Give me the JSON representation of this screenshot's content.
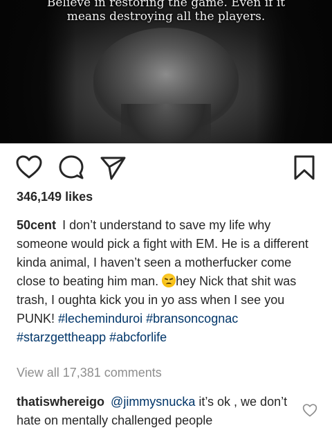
{
  "post": {
    "image": {
      "quote_line1": "Believe in restoring the game. Even if it",
      "quote_line2": "means destroying all the players."
    },
    "actions": {
      "like_icon": "heart-icon",
      "comment_icon": "comment-bubble-icon",
      "share_icon": "paper-plane-icon",
      "save_icon": "bookmark-icon"
    },
    "likes_text": "346,149 likes",
    "caption": {
      "username": "50cent",
      "text_part1": "I don’t understand to save my life why someone would pick a fight with EM. He is a different kinda animal, I haven’t seen a motherfucker come close to beating him man.",
      "emoji": "angry-face-emoji",
      "text_part2": "hey Nick that shit was trash, I oughta kick you in yo ass when I see you PUNK!",
      "hashtags": [
        "#lecheminduroi",
        "#bransoncognac",
        "#starzgettheapp",
        "#abcforlife"
      ]
    },
    "view_all_comments": "View all 17,381 comments",
    "top_comment": {
      "username": "thatiswhereigo",
      "mention": "@jimmysnucka",
      "text": "it’s ok , we don’t hate on mentally challenged people"
    },
    "colors": {
      "text": "#262626",
      "link": "#003569",
      "muted": "#8e8e8e"
    }
  }
}
